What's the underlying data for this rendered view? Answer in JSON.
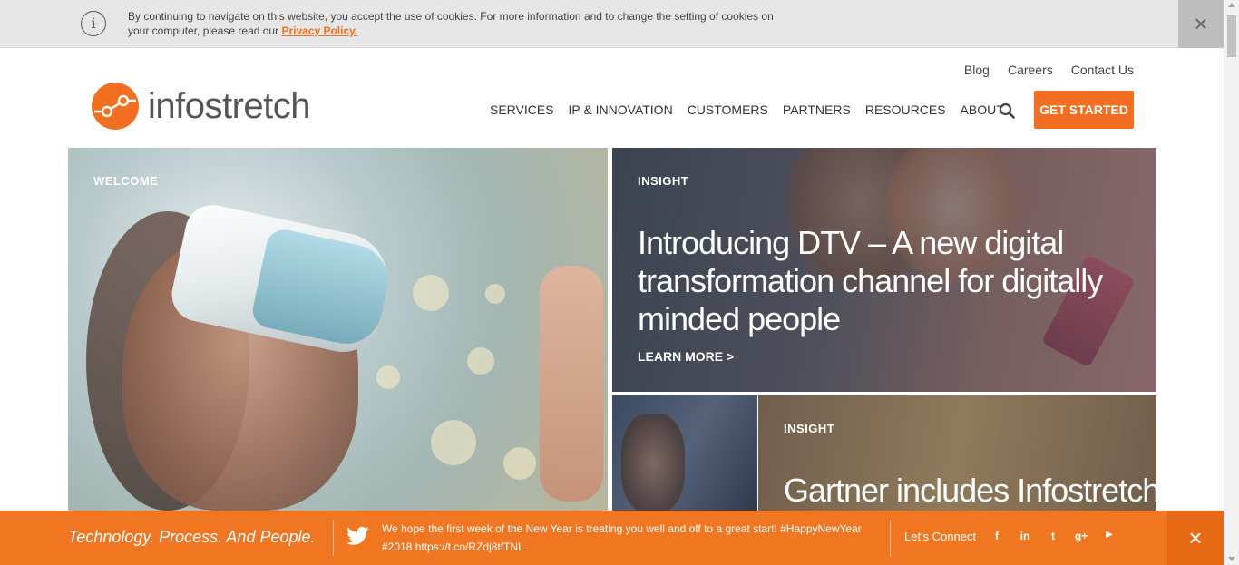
{
  "cookie_bar": {
    "info_icon": "info-icon",
    "text": "By continuing to navigate on this website, you accept the use of cookies. For more information and to change the setting of cookies on your computer, please read our ",
    "policy_link": "Privacy Policy.",
    "close_label": "×"
  },
  "header": {
    "logo_text": "infostretch",
    "top_links": [
      "Blog",
      "Careers",
      "Contact Us"
    ],
    "nav": [
      "SERVICES",
      "IP & INNOVATION",
      "CUSTOMERS",
      "PARTNERS",
      "RESOURCES",
      "ABOUT"
    ],
    "cta": "GET STARTED"
  },
  "tiles": {
    "welcome": {
      "label": "WELCOME"
    },
    "dtv": {
      "label": "INSIGHT",
      "headline": "Introducing DTV – A new digital transformation channel for digitally minded people",
      "link": "LEARN MORE >"
    },
    "gartner": {
      "label": "INSIGHT",
      "headline": "Gartner includes Infostretch i"
    }
  },
  "bottom_bar": {
    "tagline": "Technology. Process. And People.",
    "tweet": "We hope the first week of the New Year is treating you well and off to a great start! #HappyNewYear #2018 https://t.co/RZdj8tfTNL",
    "connect_label": "Let's Connect",
    "social": [
      {
        "icon": "facebook-icon",
        "glyph": "f"
      },
      {
        "icon": "linkedin-icon",
        "glyph": "in"
      },
      {
        "icon": "twitter-icon",
        "glyph": "t"
      },
      {
        "icon": "google-plus-icon",
        "glyph": "g+"
      },
      {
        "icon": "youtube-icon",
        "glyph": "▶"
      }
    ],
    "close_label": "×"
  },
  "colors": {
    "brand_orange": "#f26f21",
    "bottom_bar": "#f07622"
  }
}
